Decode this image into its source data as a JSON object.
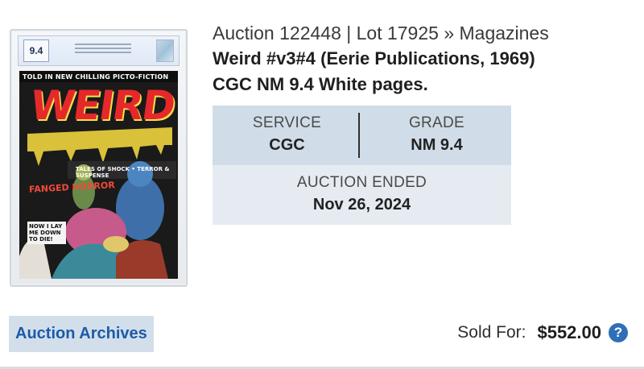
{
  "slab": {
    "grade_label": "9.4",
    "cover_banner": "TOLD IN NEW CHILLING PICTO-FICTION",
    "cover_title": "WEIRD",
    "cover_subtitle": "TALES OF SHOCK • TERROR & SUSPENSE",
    "cover_blurb1": "FANGED HORROR",
    "cover_blurb2": "NOW I LAY ME DOWN TO DIE!"
  },
  "lot": {
    "header": "Auction 122448 | Lot 17925 » Magazines",
    "title_line1": "Weird #v3#4 (Eerie Publications, 1969)",
    "title_line2": "CGC NM 9.4 White pages."
  },
  "info": {
    "service_label": "SERVICE",
    "service_value": "CGC",
    "grade_label": "GRADE",
    "grade_value": "NM 9.4",
    "ended_label": "AUCTION ENDED",
    "ended_value": "Nov 26, 2024"
  },
  "footer": {
    "archives_link": "Auction Archives",
    "sold_label": "Sold For:",
    "sold_value": "$552.00",
    "help_icon": "?"
  },
  "colors": {
    "link_blue": "#1d5aa7",
    "info_top_bg": "#d0dde8",
    "info_bottom_bg": "#e5ebf1",
    "help_bg": "#2e6fb8"
  }
}
